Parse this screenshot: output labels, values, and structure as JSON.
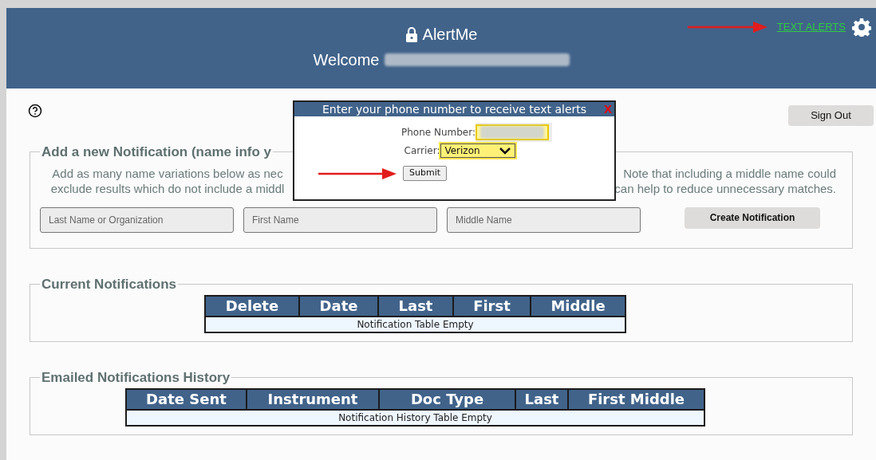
{
  "header": {
    "title": "AlertMe",
    "welcome": "Welcome",
    "text_alerts_link": "TEXT ALERTS"
  },
  "sign_out": "Sign Out",
  "add_section": {
    "legend": "Add a new Notification (name info y",
    "description_left": [
      "Add as many name variations below as nec",
      "exclude results which do not include a middl"
    ],
    "description_right": [
      "Note that including a middle name could",
      "can help to reduce unnecessary matches."
    ],
    "fields": [
      {
        "placeholder": "Last Name or Organization"
      },
      {
        "placeholder": "First Name"
      },
      {
        "placeholder": "Middle Name"
      }
    ],
    "button": "Create Notification"
  },
  "current": {
    "legend": "Current Notifications",
    "columns": [
      "Delete",
      "Date",
      "Last",
      "First",
      "Middle"
    ],
    "empty": "Notification Table Empty"
  },
  "history": {
    "legend": "Emailed Notifications History",
    "columns": [
      "Date Sent",
      "Instrument",
      "Doc Type",
      "Last",
      "First Middle"
    ],
    "empty": "Notification History Table Empty"
  },
  "dialog": {
    "title": "Enter your phone number to receive text alerts",
    "close": "X",
    "phone_label": "Phone Number:",
    "carrier_label": "Carrier:",
    "carrier": "Verizon",
    "submit": "Submit"
  }
}
